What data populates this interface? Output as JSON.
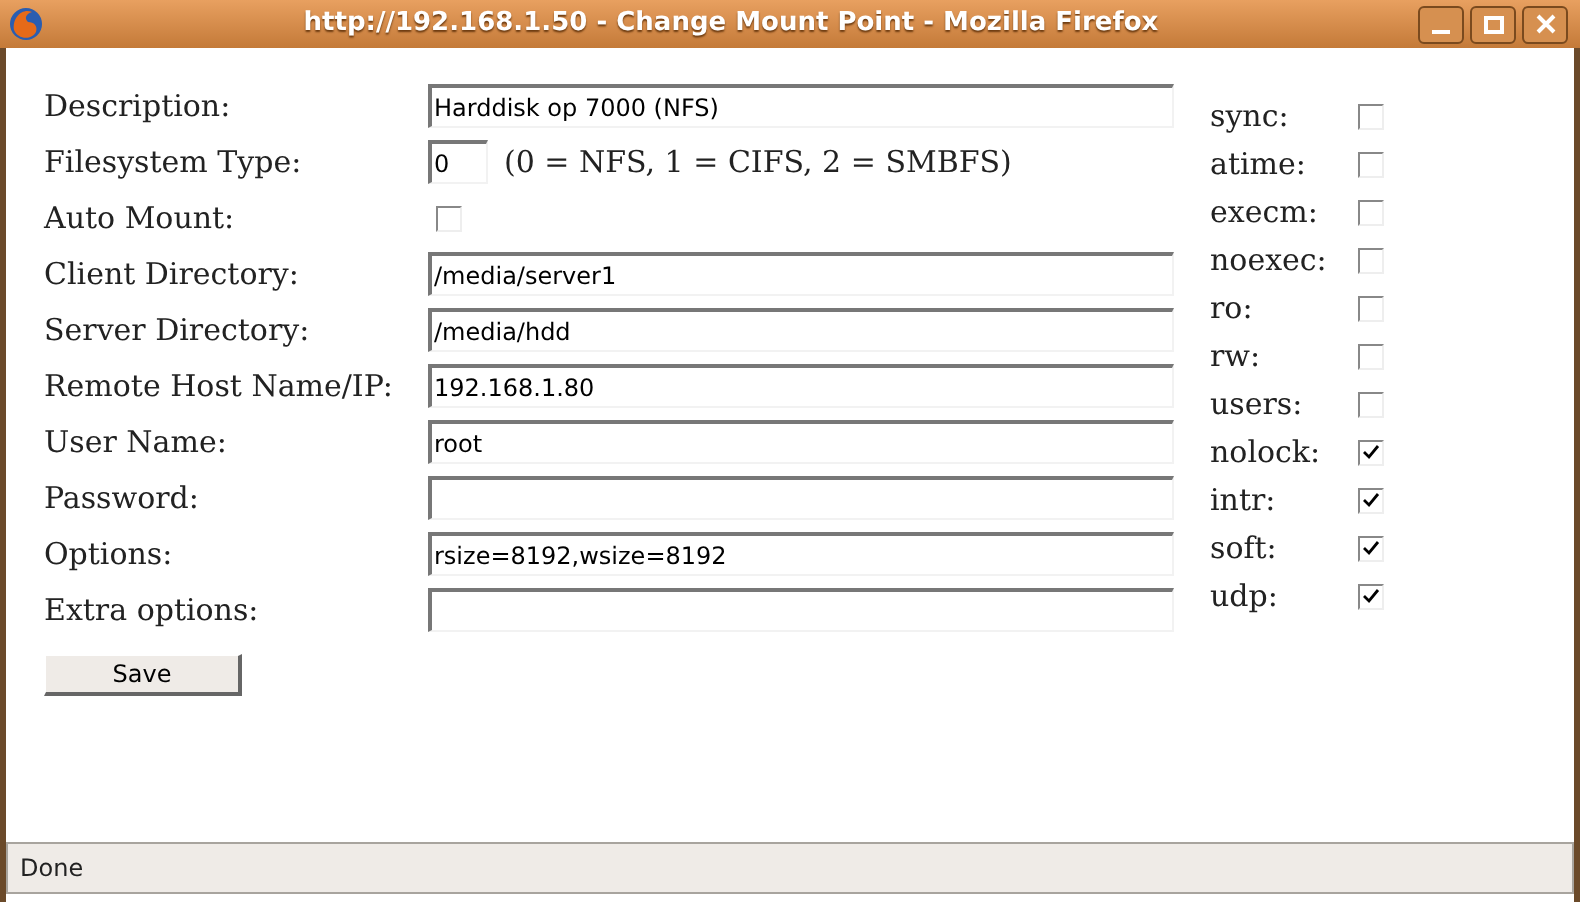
{
  "window": {
    "title": "http://192.168.1.50 - Change Mount Point - Mozilla Firefox"
  },
  "form": [
    {
      "kind": "text",
      "label": "Description:",
      "value": "Harddisk op 7000 (NFS)"
    },
    {
      "kind": "short",
      "label": "Filesystem Type:",
      "value": "0",
      "hint": "(0 = NFS, 1 = CIFS, 2 = SMBFS)"
    },
    {
      "kind": "checkbox",
      "label": "Auto Mount:",
      "checked": false
    },
    {
      "kind": "text",
      "label": "Client Directory:",
      "value": "/media/server1"
    },
    {
      "kind": "text",
      "label": "Server Directory:",
      "value": "/media/hdd"
    },
    {
      "kind": "text",
      "label": "Remote Host Name/IP:",
      "value": "192.168.1.80"
    },
    {
      "kind": "text",
      "label": "User Name:",
      "value": "root"
    },
    {
      "kind": "text",
      "label": "Password:"
    },
    {
      "kind": "text",
      "label": "Options:",
      "value": "rsize=8192,wsize=8192"
    },
    {
      "kind": "text",
      "label": "Extra options:"
    }
  ],
  "flags": [
    {
      "label": "sync:",
      "checked": false
    },
    {
      "label": "atime:",
      "checked": false
    },
    {
      "label": "execm:",
      "checked": false
    },
    {
      "label": "noexec:",
      "checked": false
    },
    {
      "label": "ro:",
      "checked": false
    },
    {
      "label": "rw:",
      "checked": false
    },
    {
      "label": "users:",
      "checked": false
    },
    {
      "label": "nolock:",
      "checked": true
    },
    {
      "label": "intr:",
      "checked": true
    },
    {
      "label": "soft:",
      "checked": true
    },
    {
      "label": "udp:",
      "checked": true
    }
  ],
  "save_button": "Save",
  "status_bar": "Done"
}
